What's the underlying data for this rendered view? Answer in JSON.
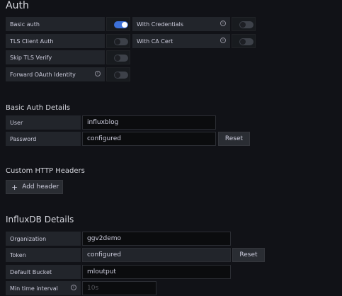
{
  "auth": {
    "title": "Auth",
    "rows": [
      {
        "label": "Basic auth",
        "on": true
      },
      {
        "label": "TLS Client Auth",
        "on": false
      },
      {
        "label": "Skip TLS Verify",
        "on": false
      },
      {
        "label": "Forward OAuth Identity",
        "on": false
      }
    ],
    "right_rows": [
      {
        "label": "With Credentials",
        "on": false
      },
      {
        "label": "With CA Cert",
        "on": false
      }
    ]
  },
  "basic_auth": {
    "title": "Basic Auth Details",
    "user_label": "User",
    "user_value": "influxblog",
    "password_label": "Password",
    "password_value": "configured",
    "reset_label": "Reset"
  },
  "headers": {
    "title": "Custom HTTP Headers",
    "add_icon": "+",
    "add_label": "Add header"
  },
  "influx": {
    "title": "InfluxDB Details",
    "organization_label": "Organization",
    "organization_value": "ggv2demo",
    "token_label": "Token",
    "token_value": "configured",
    "reset_label": "Reset",
    "bucket_label": "Default Bucket",
    "bucket_value": "mloutput",
    "min_interval_label": "Min time interval",
    "min_interval_placeholder": "10s"
  },
  "icons": {
    "info": "i"
  },
  "colors": {
    "toggle_on": "#3d71d9",
    "background": "#111217"
  }
}
